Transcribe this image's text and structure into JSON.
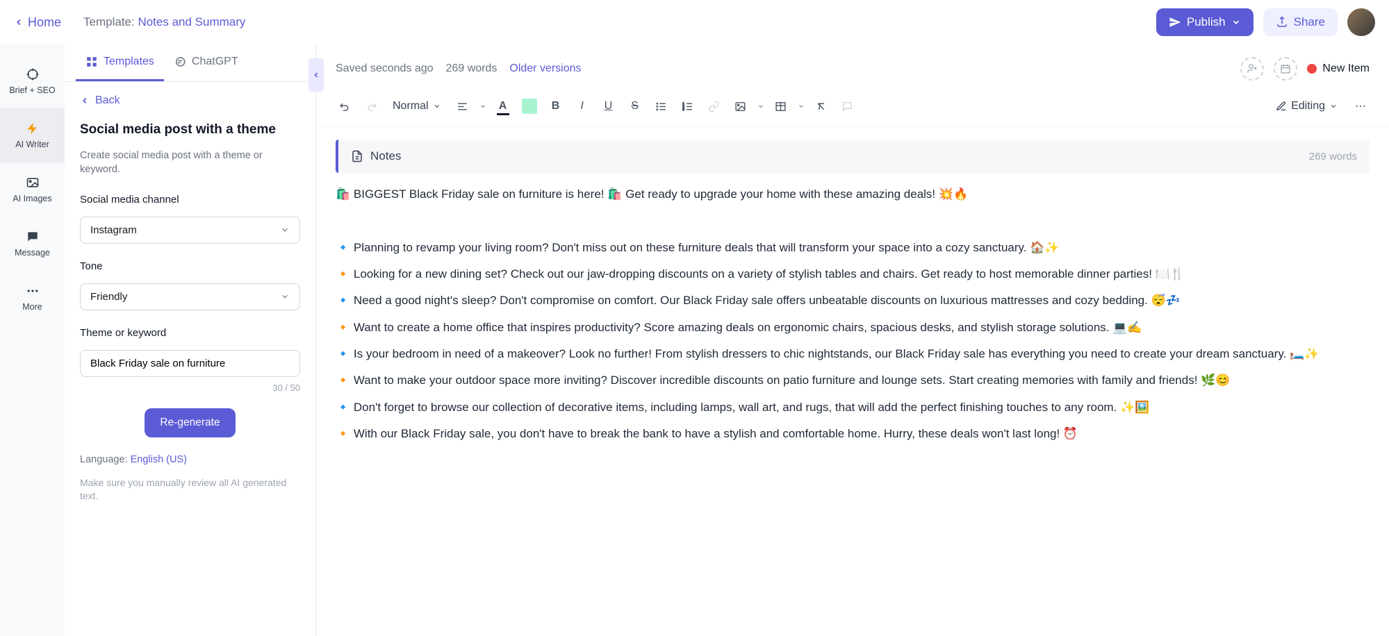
{
  "header": {
    "home": "Home",
    "template_prefix": "Template: ",
    "template_name": "Notes and Summary",
    "publish": "Publish",
    "share": "Share"
  },
  "rail": {
    "brief": "Brief + SEO",
    "writer": "AI Writer",
    "images": "AI Images",
    "message": "Message",
    "more": "More"
  },
  "tabs": {
    "templates": "Templates",
    "chatgpt": "ChatGPT"
  },
  "sidebar": {
    "back": "Back",
    "title": "Social media post with a theme",
    "desc": "Create social media post with a theme or keyword.",
    "channel_label": "Social media channel",
    "channel_value": "Instagram",
    "tone_label": "Tone",
    "tone_value": "Friendly",
    "theme_label": "Theme or keyword",
    "theme_value": "Black Friday sale on furniture",
    "char_count": "30 / 50",
    "regenerate": "Re-generate",
    "lang_prefix": "Language: ",
    "lang_value": "English (US)",
    "disclaimer": "Make sure you manually review all AI generated text."
  },
  "meta": {
    "saved": "Saved seconds ago",
    "words": "269 words",
    "older": "Older versions",
    "new_item": "New Item"
  },
  "toolbar": {
    "style": "Normal",
    "editing": "Editing"
  },
  "notes": {
    "label": "Notes",
    "count": "269 words"
  },
  "content": {
    "p0": "🛍️ BIGGEST Black Friday sale on furniture is here! 🛍️ Get ready to upgrade your home with these amazing deals! 💥🔥",
    "p1": "🔹 Planning to revamp your living room? Don't miss out on these furniture deals that will transform your space into a cozy sanctuary. 🏠✨",
    "p2": "🔸 Looking for a new dining set? Check out our jaw-dropping discounts on a variety of stylish tables and chairs. Get ready to host memorable dinner parties! 🍽️🍴",
    "p3": "🔹 Need a good night's sleep? Don't compromise on comfort. Our Black Friday sale offers unbeatable discounts on luxurious mattresses and cozy bedding. 😴💤",
    "p4": "🔸 Want to create a home office that inspires productivity? Score amazing deals on ergonomic chairs, spacious desks, and stylish storage solutions. 💻✍️",
    "p5": "🔹 Is your bedroom in need of a makeover? Look no further! From stylish dressers to chic nightstands, our Black Friday sale has everything you need to create your dream sanctuary. 🛏️✨",
    "p6": "🔸 Want to make your outdoor space more inviting? Discover incredible discounts on patio furniture and lounge sets. Start creating memories with family and friends! 🌿😊",
    "p7": "🔹 Don't forget to browse our collection of decorative items, including lamps, wall art, and rugs, that will add the perfect finishing touches to any room. ✨🖼️",
    "p8": "🔸 With our Black Friday sale, you don't have to break the bank to have a stylish and comfortable home. Hurry, these deals won't last long! ⏰"
  }
}
